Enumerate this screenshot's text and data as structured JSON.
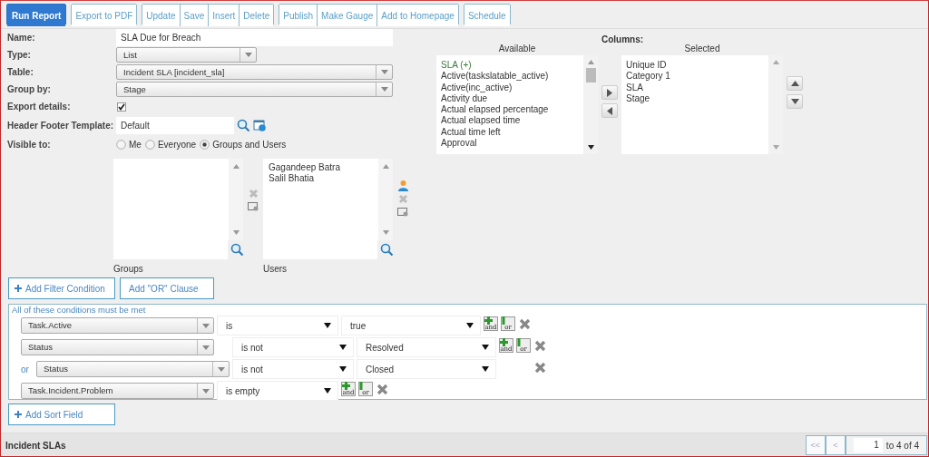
{
  "toolbar": [
    {
      "kind": "primary",
      "buttons": [
        "Run Report"
      ]
    },
    {
      "kind": "default",
      "buttons": [
        "Export to PDF"
      ]
    },
    {
      "kind": "default",
      "buttons": [
        "Update",
        "Save",
        "Insert",
        "Delete"
      ]
    },
    {
      "kind": "default",
      "buttons": [
        "Publish",
        "Make Gauge",
        "Add to Homepage"
      ]
    },
    {
      "kind": "default",
      "buttons": [
        "Schedule"
      ]
    }
  ],
  "form": {
    "name": {
      "label": "Name:",
      "value": "SLA Due for Breach"
    },
    "type": {
      "label": "Type:",
      "value": "List"
    },
    "table": {
      "label": "Table:",
      "value": "Incident SLA [incident_sla]"
    },
    "group_by": {
      "label": "Group by:",
      "value": "Stage"
    },
    "export_details": {
      "label": "Export details:",
      "checked": true
    },
    "header_footer_template": {
      "label": "Header Footer Template:",
      "value": "Default"
    },
    "visible_to": {
      "label": "Visible to:",
      "options": [
        {
          "label": "Me",
          "selected": false
        },
        {
          "label": "Everyone",
          "selected": false
        },
        {
          "label": "Groups and Users",
          "selected": true
        }
      ]
    }
  },
  "groups": {
    "caption": "Groups"
  },
  "users": {
    "caption": "Users",
    "items": [
      "Gagandeep Batra",
      "Salil Bhatia"
    ]
  },
  "columns": {
    "title": "Columns:",
    "available": {
      "header": "Available",
      "items": [
        {
          "label": "SLA (+)",
          "kind": "group"
        },
        {
          "label": "Active(taskslatable_active)",
          "kind": "field"
        },
        {
          "label": "Active(inc_active)",
          "kind": "field"
        },
        {
          "label": "Activity due",
          "kind": "field"
        },
        {
          "label": "Actual elapsed percentage",
          "kind": "field"
        },
        {
          "label": "Actual elapsed time",
          "kind": "field"
        },
        {
          "label": "Actual time left",
          "kind": "field"
        },
        {
          "label": "Approval",
          "kind": "field"
        }
      ]
    },
    "selected": {
      "header": "Selected",
      "items": [
        "Unique ID",
        "Category 1",
        "SLA",
        "Stage"
      ]
    }
  },
  "filter_buttons": [
    {
      "label": "Add Filter Condition",
      "plus": true
    },
    {
      "label": "Add \"OR\" Clause",
      "plus": false
    }
  ],
  "conditions": {
    "header": "All of these conditions must be met",
    "items": [
      {
        "kind": "single",
        "rows": [
          {
            "field": "Task.Active",
            "operator": "is",
            "value": "true",
            "add_buttons": [
              "and",
              "or"
            ]
          }
        ]
      },
      {
        "kind": "or_group",
        "rows": [
          {
            "field": "Status",
            "operator": "is not",
            "value": "Resolved",
            "add_buttons": [
              "and",
              "or"
            ]
          },
          {
            "connector": "or",
            "field": "Status",
            "operator": "is not",
            "value": "Closed"
          }
        ]
      },
      {
        "kind": "single",
        "rows": [
          {
            "field": "Task.Incident.Problem",
            "operator": "is empty",
            "add_buttons": [
              "and",
              "or"
            ]
          }
        ]
      }
    ]
  },
  "sort_button": {
    "label": "Add Sort Field"
  },
  "footer": {
    "title": "Incident SLAs",
    "pager": {
      "first": "<<",
      "prev": "<",
      "disabled": true,
      "page": "1",
      "range": "to 4 of 4"
    }
  }
}
